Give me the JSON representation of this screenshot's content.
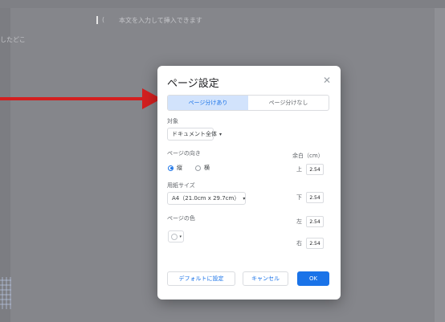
{
  "background": {
    "hint_text": "本文を入力して挿入できます",
    "hint_prefix": "(",
    "side_text": "したどこ"
  },
  "dialog": {
    "title": "ページ設定",
    "close_icon": "✕",
    "tabs": [
      {
        "label": "ページ分けあり",
        "active": true
      },
      {
        "label": "ページ分けなし",
        "active": false
      }
    ],
    "apply_to": {
      "label": "対象",
      "value": "ドキュメント全体"
    },
    "orientation": {
      "label": "ページの向き",
      "options": [
        {
          "label": "縦",
          "selected": true
        },
        {
          "label": "横",
          "selected": false
        }
      ]
    },
    "paper_size": {
      "label": "用紙サイズ",
      "value": "A4（21.0cm x 29.7cm）"
    },
    "page_color": {
      "label": "ページの色"
    },
    "margins": {
      "label": "余白（cm）",
      "top": {
        "label": "上",
        "value": "2.54"
      },
      "bottom": {
        "label": "下",
        "value": "2.54"
      },
      "left": {
        "label": "左",
        "value": "2.54"
      },
      "right": {
        "label": "右",
        "value": "2.54"
      }
    },
    "buttons": {
      "default": "デフォルトに設定",
      "cancel": "キャンセル",
      "ok": "OK"
    }
  },
  "colors": {
    "accent": "#1a73e8",
    "arrow": "#d31f1f"
  }
}
